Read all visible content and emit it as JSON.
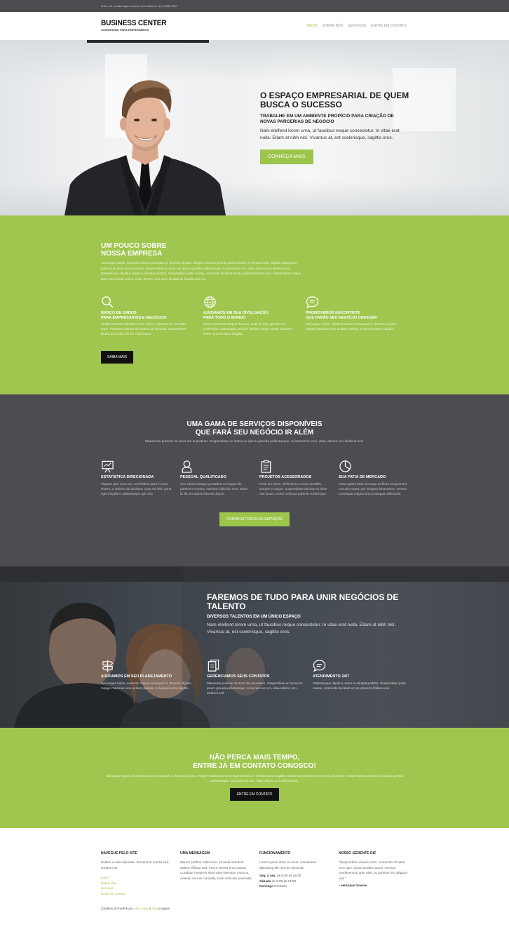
{
  "topbar": {
    "text": "Entre em contato agora mesmo pelo telefone (12) 3456-7890"
  },
  "header": {
    "logo_title": "BUSINESS CENTER",
    "logo_sub": "COWORKING PARA EMPRESÁRIOS",
    "nav": [
      {
        "label": "INÍCIO",
        "active": true
      },
      {
        "label": "SOBRE NÓS",
        "active": false
      },
      {
        "label": "SERVIÇOS",
        "active": false
      },
      {
        "label": "ENTRE EM CONTATO",
        "active": false
      }
    ]
  },
  "hero": {
    "title": "O ESPAÇO EMPRESARIAL DE QUEM BUSCA O SUCESSO",
    "subtitle": "TRABALHE EM UM AMBIENTE PROPÍCIO PARA CRIAÇÃO DE NOVAS PARCERIAS DE NEGÓCIO",
    "text": "Nam eleifend lorem urna, ut faucibus neque consectetur. In vitae erat nulla. Etiam at nibh nisl. Vivamus at, est scelerisque, sagittis eros.",
    "button": "CONHEÇA MAIS"
  },
  "about": {
    "title_line1": "UM POUCO SOBRE",
    "title_line2": "NOSSA EMPRESA",
    "text": "Sed augue turpis, euismod cursus consequat id, rhoncus id justo. Integer maximus eros at diam pretium, in tempus tortor sagittis. Maecenas pulvinar sit amet dui at pretium. Suspendisse ac lectus ac ipsum gravida pellentesque. In laoreet leo orci, vitae ultrices orci eleifend sed. Pellentesque dapibus metus a volutpat porttitor. Suspendisse justo massa, commodo tincidunt est at, pharetra finibus eros. Suspendisse neque enim, accumsan sed ut, enim. Donec eros urna, facilisis at, feugiat quis nis.",
    "features": [
      {
        "icon": "search-icon",
        "title_line1": "BANCO DE DADOS",
        "title_line2": "PARA EMPRESÁRIOS E NEGÓCIOS",
        "text": "Nullam pharetra dignissim eros. Nam ut egestas ex, ut mattis tortor. Praesent sodales est sapien ac vehicula. Suspendisse iaculis quis nulla rutrum scelerisque."
      },
      {
        "icon": "globe-icon",
        "title_line1": "AJUDAMOS EM SUA DIVULGAÇÃO",
        "title_line2": "PARA TODO O MUNDO",
        "text": "Donec maximus tempus rhoncus. Cras mi erat, gravida eu scelerisque malesuada, pulvinar facilisis neque. Morbi maximus lorem sit amet tellus fringilla."
      },
      {
        "icon": "chat-icon",
        "title_line1": "PROMOVEMOS ENCONTROS",
        "title_line2": "QUE FARÃO SEU NEGÓCIO CRESCER",
        "text": "Sed augue turpis, euismod cursus consequat id, rhoncus id justo. Integer maximus eros at diam pretium, in tempus tortor sagittis."
      }
    ],
    "button": "SAIBA MAIS"
  },
  "services": {
    "title_line1": "UMA GAMA DE SERVIÇOS DISPONÍVEIS",
    "title_line2": "QUE FARÁ SEU NEGÓCIO IR ALÉM",
    "subtitle": "Maecenas pulvinar sit amet dui at pretium. Suspendisse ac lectus ac ipsum gravida pellentesque. In laoreet leo orci, vitae ultrices orci eleifend sed.",
    "features": [
      {
        "icon": "presentation-icon",
        "title": "ESTATÍSTICA DIRECIONADA",
        "text": "Aliquam quis urna orci. Sed finibus justo in nunc viverra, a ultrices dui tincidunt. Cras est felis, porta eget fringilla a, pellentesque quis nisi."
      },
      {
        "icon": "user-icon",
        "title": "PESSOAL QUALIFICADO",
        "text": "Orci varius natoque penatibus et magnis dis parturient montes, nascetur ridiculus mus. Etiam id elit nec ipsum lobortis dictum."
      },
      {
        "icon": "clipboard-icon",
        "title": "PROJETOS ACESSORADOS",
        "text": "Proin dui lorem, eleifend eu cursus convallis, semper et augue. Suspendisse pulvinar eu dolor non luctus. Donec vehicula pulvinar scelerisque."
      },
      {
        "icon": "pie-chart-icon",
        "title": "SUA FATIA DE MERCADO",
        "text": "Class aptent taciti sociosqu ad litora torquent per conubia nostra, per inceptos himenaeos. Aenean consequat magna sed consequat sollicitudin."
      }
    ],
    "button": "CONHEÇA TODOS OS SERVIÇOS"
  },
  "team": {
    "title": "FAREMOS DE TUDO PARA UNIR NEGÓCIOS DE TALENTO",
    "subtitle": "DIVERSOS TALENTOS EM UM ÚNICO ESPAÇO",
    "text": "Nam eleifend lorem urna, ut faucibus neque consectetur. In vitae erat nulla. Etiam at nibh nisl. Vivamus at, est scelerisque, sagittis eros.",
    "features": [
      {
        "icon": "signpost-icon",
        "title": "AJUDAMOS EM SEU PLANEJAMENTO",
        "text": "Sed augue turpis, euismod cursus consequat id, rhoncus id justo. Integer maximus eros at diam pretium, in tempus tortor sagittis."
      },
      {
        "icon": "documents-icon",
        "title": "GERENCIAMOS SEUS CONTATOS",
        "text": "Maecenas pulvinar sit amet dui at pretium. Suspendisse ac lectus ac ipsum gravida pellentesque. In laoreet leo orci, vitae ultrices orci eleifend sed."
      },
      {
        "icon": "chat-icon",
        "title": "ATENDIMENTO 24/7",
        "text": "Pellentesque dapibus metus a volutpat porttitor. Suspendisse justo massa, commodo tincidunt est at, pharetra finibus eros."
      }
    ]
  },
  "cta": {
    "title_line1": "NÃO PERCA MAIS TEMPO,",
    "title_line2": "ENTRE JÁ EM CONTATO CONOSCO!",
    "text": "Sed augue turpis, euismod cursus consequat id, rhoncus id justo. Integer maximus eros at diam pretium, in tempus tortor sagittis. Maecenas pulvinar sit amet dui at pretium. Suspendisse ac lectus ac ipsum gravida pellentesque. In laoreet leo orci, vitae ultrices orci eleifend sed.",
    "button": "ENTRE EM CONTATO"
  },
  "footer": {
    "nav": {
      "title": "NAVEGUE PELO SITE",
      "text": "Nullam a odio vulputate, fermentum massa sed, tempus nisi.",
      "links": [
        "Início",
        "Sobre Nós",
        "Serviços",
        "Entre em contato"
      ]
    },
    "message": {
      "title": "UMA MENSAGEM",
      "text": "Mauris porttitor nulla nunc, sit amet interdum sapien efficitur sed. Fusce viverra eros massa. Curabitur hendrerit risus vitae interdum rhoncus. Aenean vel nisi convallis, enim vehicula venenatis."
    },
    "hours": {
      "title": "FUNCIONAMENTO",
      "text": "Lorem ipsum dolor sit amet, consectetur adipiscing elit, sed do eiusmod.",
      "rows": [
        {
          "day": "Seg. à sex.",
          "time": "de 8:30 às 18:30"
        },
        {
          "day": "Sábado",
          "time": "de 9:00 às 14:00"
        },
        {
          "day": "Domingo",
          "time": "Fechado"
        }
      ]
    },
    "manager": {
      "title": "NOSSO GERENTE DIZ",
      "quote": "\"Suspendisse mauris enim, commodo sit amet eros quis, varius porttitor purus. Aenean condimentum ante nibh, ac pulvinar nisl aliquam sed.\"",
      "author": "– Henrique Soares"
    },
    "credits": {
      "prefix": "Créditos à FreePik por",
      "link1": "esta",
      "sep1": ",",
      "link2": "esta",
      "sep2": "e",
      "link3": "esta",
      "suffix": "imagem."
    }
  },
  "colors": {
    "accent": "#9dc44b",
    "green_bg": "#a1c64f",
    "dark_bg": "#4b4d51"
  }
}
